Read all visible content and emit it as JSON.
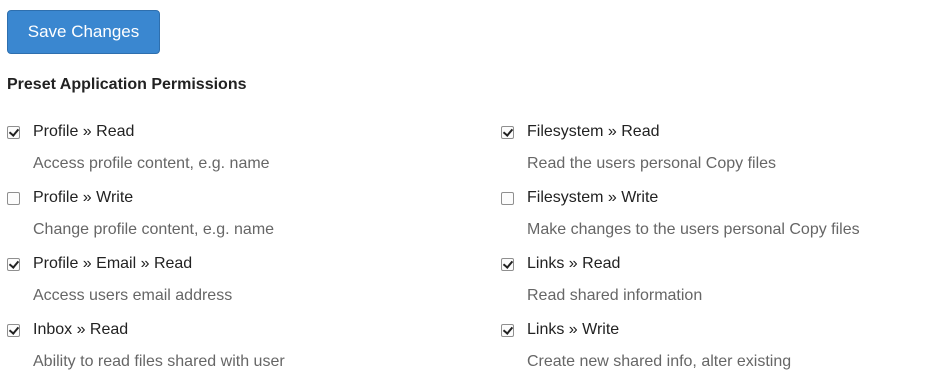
{
  "toolbar": {
    "save_label": "Save Changes"
  },
  "section": {
    "title": "Preset Application Permissions"
  },
  "colors": {
    "button": "#3a87d0",
    "heading": "#222222",
    "description": "#666666"
  },
  "permissions": {
    "left": [
      {
        "label": "Profile » Read",
        "description": "Access profile content, e.g. name",
        "checked": true
      },
      {
        "label": "Profile » Write",
        "description": "Change profile content, e.g. name",
        "checked": false
      },
      {
        "label": "Profile » Email » Read",
        "description": "Access users email address",
        "checked": true
      },
      {
        "label": "Inbox » Read",
        "description": "Ability to read files shared with user",
        "checked": true
      }
    ],
    "right": [
      {
        "label": "Filesystem » Read",
        "description": "Read the users personal Copy files",
        "checked": true
      },
      {
        "label": "Filesystem » Write",
        "description": "Make changes to the users personal Copy files",
        "checked": false
      },
      {
        "label": "Links » Read",
        "description": "Read shared information",
        "checked": true
      },
      {
        "label": "Links » Write",
        "description": "Create new shared info, alter existing",
        "checked": true
      }
    ]
  }
}
